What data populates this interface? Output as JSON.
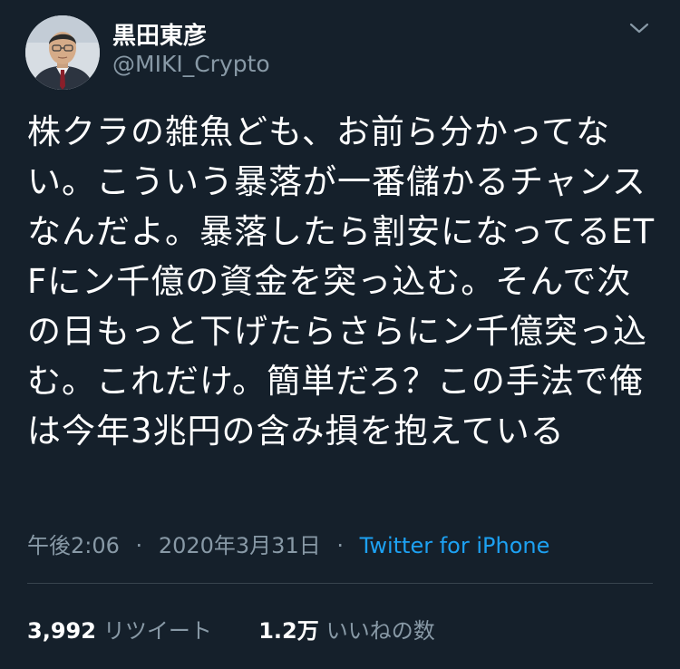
{
  "user": {
    "display_name": "黒田東彦",
    "handle": "@MIKI_Crypto"
  },
  "tweet": {
    "text": "株クラの雑魚ども、お前ら分かってない。こういう暴落が一番儲かるチャンスなんだよ。暴落したら割安になってるETFにン千億の資金を突っ込む。そんで次の日もっと下げたらさらにン千億突っ込む。これだけ。簡単だろ？この手法で俺は今年3兆円の含み損を抱えている",
    "time": "午後2:06",
    "date": "2020年3月31日",
    "separator": "·",
    "source": "Twitter for iPhone"
  },
  "stats": {
    "retweets_count": "3,992",
    "retweets_label": "リツイート",
    "likes_count": "1.2万",
    "likes_label": "いいねの数"
  },
  "icons": {
    "avatar": "avatar-photo",
    "menu": "chevron-down-icon"
  },
  "colors": {
    "background": "#15202b",
    "secondary_text": "#8899a6",
    "link": "#1da1f2",
    "divider": "#38444d"
  }
}
